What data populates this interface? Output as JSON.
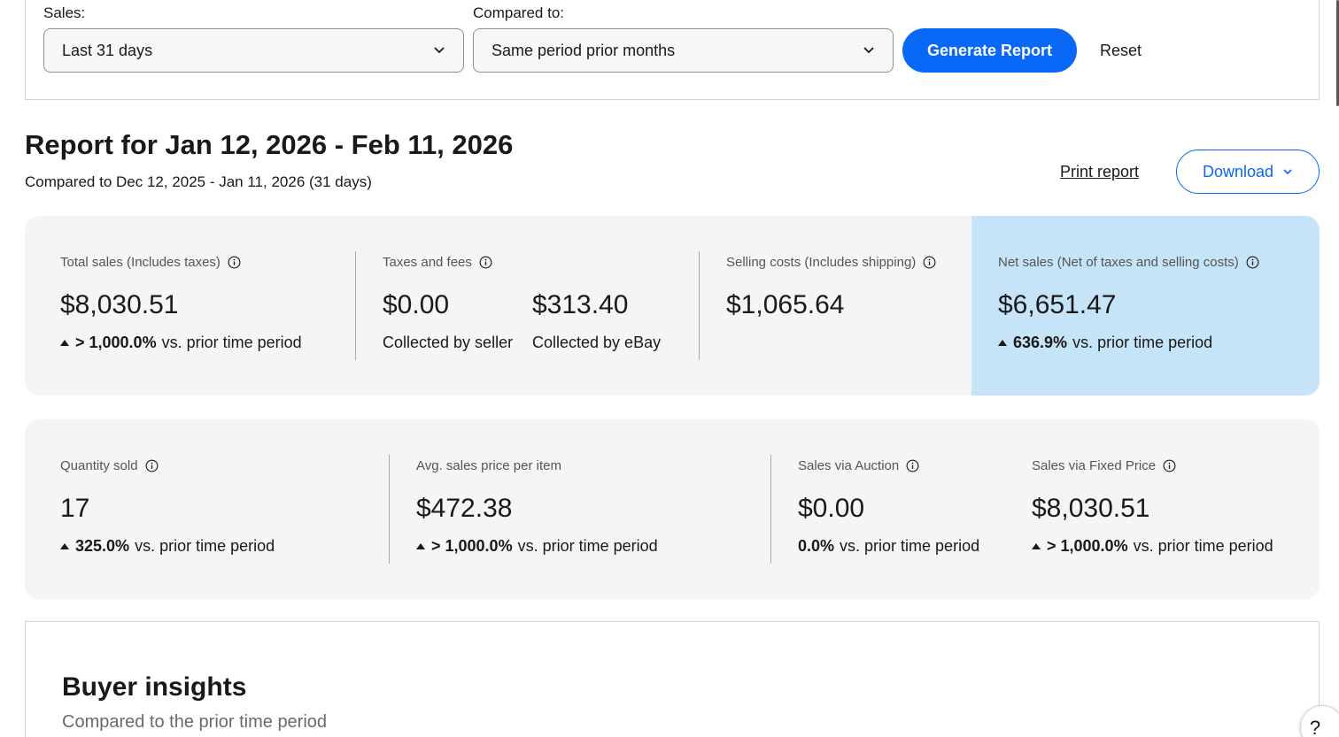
{
  "filters": {
    "sales_label": "Sales:",
    "sales_value": "Last 31 days",
    "compared_label": "Compared to:",
    "compared_value": "Same period prior months",
    "generate_label": "Generate Report",
    "reset_label": "Reset"
  },
  "report": {
    "title": "Report for Jan 12, 2026 - Feb 11, 2026",
    "subtitle": "Compared to Dec 12, 2025 - Jan 11, 2026 (31 days)",
    "print_label": "Print report",
    "download_label": "Download"
  },
  "summary": {
    "total_sales": {
      "label": "Total sales (Includes taxes)",
      "value": "$8,030.51",
      "delta": "> 1,000.0%",
      "delta_text": "vs. prior time period"
    },
    "taxes_fees": {
      "label": "Taxes and fees",
      "seller_value": "$0.00",
      "seller_label": "Collected by seller",
      "ebay_value": "$313.40",
      "ebay_label": "Collected by eBay"
    },
    "selling_costs": {
      "label": "Selling costs (Includes shipping)",
      "value": "$1,065.64"
    },
    "net_sales": {
      "label": "Net sales (Net of taxes and selling costs)",
      "value": "$6,651.47",
      "delta": "636.9%",
      "delta_text": "vs. prior time period"
    }
  },
  "details": {
    "quantity": {
      "label": "Quantity sold",
      "value": "17",
      "delta": "325.0%",
      "delta_text": "vs. prior time period"
    },
    "avg_price": {
      "label": "Avg. sales price per item",
      "value": "$472.38",
      "delta": "> 1,000.0%",
      "delta_text": "vs. prior time period"
    },
    "auction": {
      "label": "Sales via Auction",
      "value": "$0.00",
      "delta": "0.0%",
      "delta_text": "vs. prior time period"
    },
    "fixed_price": {
      "label": "Sales via Fixed Price",
      "value": "$8,030.51",
      "delta": "> 1,000.0%",
      "delta_text": "vs. prior time period"
    }
  },
  "insights": {
    "title": "Buyer insights",
    "subtitle": "Compared to the prior time period"
  },
  "help": {
    "label": "?"
  },
  "colors": {
    "primary": "#0968f6",
    "card_bg": "#f5f5f5",
    "highlight_bg": "#c6e4f7"
  }
}
